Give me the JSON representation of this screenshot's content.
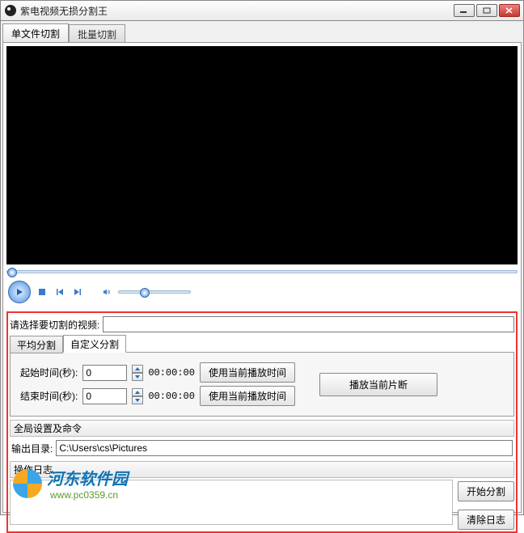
{
  "window": {
    "title": "紫电视频无损分割王"
  },
  "tabs": {
    "single": "单文件切割",
    "batch": "批量切割"
  },
  "select_video_label": "请选择要切割的视频:",
  "select_video_value": "",
  "subtabs": {
    "avg": "平均分割",
    "custom": "自定义分割"
  },
  "time": {
    "start_label": "起始时间(秒):",
    "start_value": "0",
    "start_time": "00:00:00",
    "end_label": "结束时间(秒):",
    "end_value": "0",
    "end_time": "00:00:00",
    "use_current": "使用当前播放时间",
    "play_segment": "播放当前片断"
  },
  "global": {
    "title": "全局设置及命令",
    "output_label": "输出目录:",
    "output_value": "C:\\Users\\cs\\Pictures"
  },
  "log_title": "操作日志",
  "buttons": {
    "start": "开始分割",
    "clear": "清除日志"
  },
  "watermark": {
    "name": "河东软件园",
    "url": "www.pc0359.cn"
  }
}
